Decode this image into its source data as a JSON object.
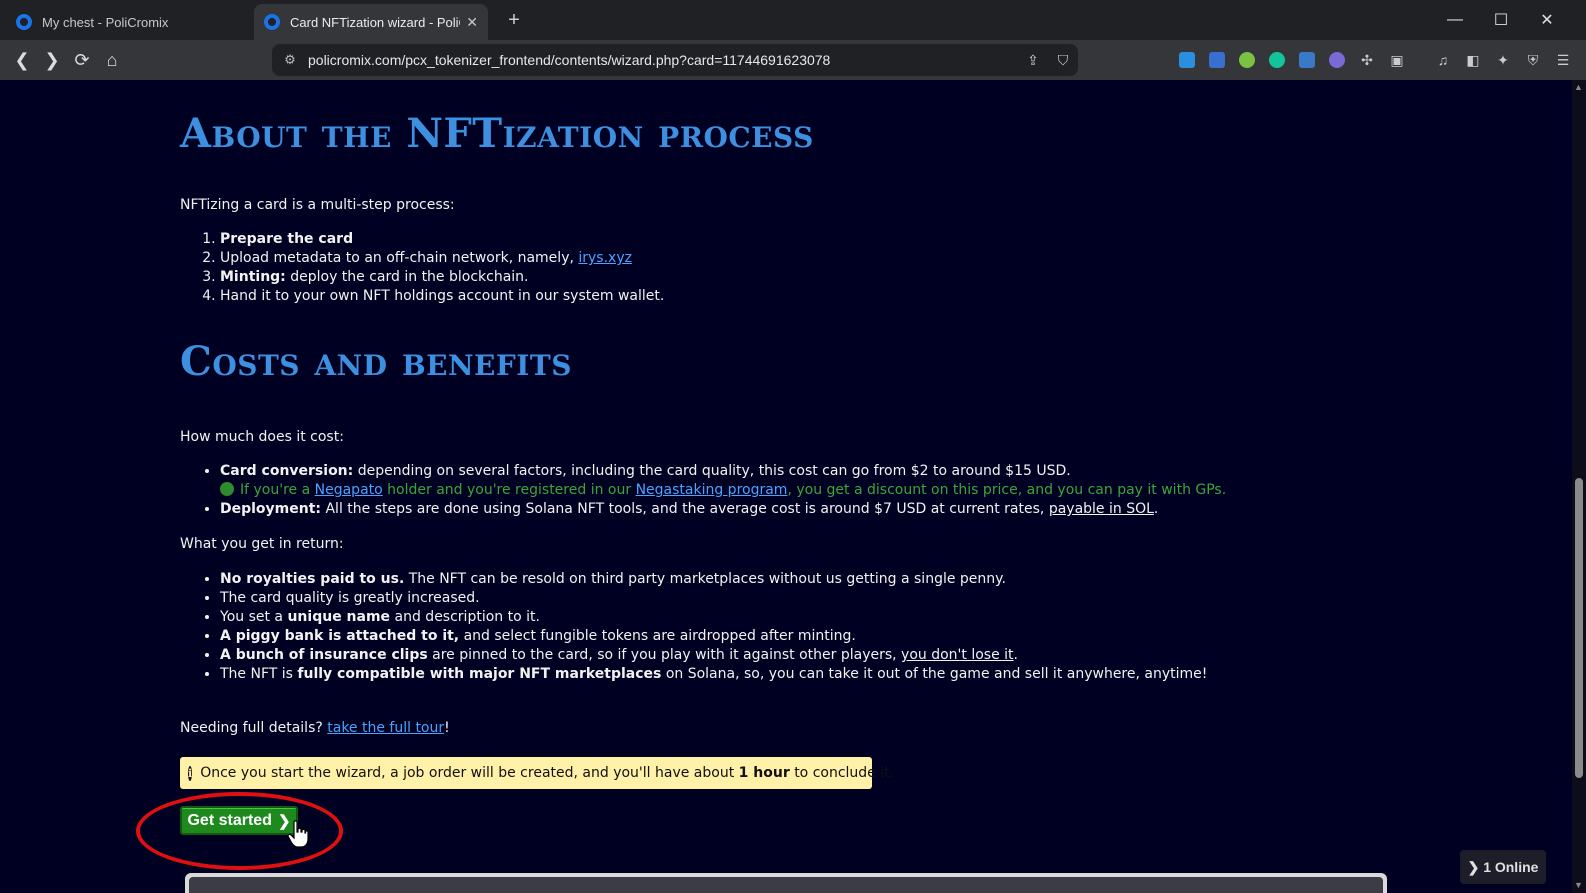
{
  "browser": {
    "tabs": [
      {
        "title": "My chest - PoliCromix",
        "active": false
      },
      {
        "title": "Card NFTization wizard - PoliCromix",
        "active": true
      }
    ],
    "url": "policromix.com/pcx_tokenizer_frontend/contents/wizard.php?card=11744691623078",
    "window_controls": [
      "minimize-icon",
      "maximize-icon",
      "close-icon"
    ]
  },
  "page": {
    "heading1": "About the NFTization process",
    "intro": "NFTizing a card is a multi-step process:",
    "steps": [
      {
        "bold": "Prepare the card",
        "text": "",
        "link": ""
      },
      {
        "bold": "",
        "text": "Upload metadata to an off-chain network, namely, ",
        "link": "irys.xyz"
      },
      {
        "bold": "Minting:",
        "text": " deploy the card in the blockchain.",
        "link": ""
      },
      {
        "bold": "",
        "text": "Hand it to your own NFT holdings account in our system wallet.",
        "link": ""
      }
    ],
    "heading2": "Costs and benefits",
    "cost_intro": "How much does it cost:",
    "costs": {
      "conversion_bold": "Card conversion:",
      "conversion_text": " depending on several factors, including the card quality, this cost can go from $2 to around $15 USD.",
      "discount_pre": "If you're a ",
      "discount_link1": "Negapato",
      "discount_mid": " holder and you're registered in our ",
      "discount_link2": "Negastaking program",
      "discount_post": ", you get a discount on this price, and you can pay it with GPs.",
      "deployment_bold": "Deployment:",
      "deployment_text": " All the steps are done using Solana NFT tools, and the average cost is around $7 USD at current rates, ",
      "deployment_link": "payable in SOL",
      "deployment_end": "."
    },
    "return_intro": "What you get in return:",
    "benefits": {
      "b1_bold": "No royalties paid to us.",
      "b1_text": " The NFT can be resold on third party marketplaces without us getting a single penny.",
      "b2_text": "The card quality is greatly increased.",
      "b3_pre": "You set a ",
      "b3_bold": "unique name",
      "b3_post": " and description to it.",
      "b4_bold": "A piggy bank is attached to it,",
      "b4_text": " and select fungible tokens are airdropped after minting.",
      "b5_bold": "A bunch of insurance clips",
      "b5_text": " are pinned to the card, so if you play with it against other players, ",
      "b5_link": "you don't lose it",
      "b5_end": ".",
      "b6_pre": "The NFT is ",
      "b6_bold": "fully compatible with major NFT marketplaces",
      "b6_post": " on Solana, so, you can take it out of the game and sell it anywhere, anytime!"
    },
    "details_pre": "Needing full details? ",
    "details_link": "take the full tour",
    "details_end": "!",
    "notice_pre": "Once you start the wizard, a job order will be created, and you'll have about ",
    "notice_bold": "1 hour",
    "notice_post": " to conclude it.",
    "start_button": "Get started",
    "online_badge": "1 Online"
  },
  "colors": {
    "page_bg": "#000022",
    "heading": "#3d8fe0",
    "link": "#4aa3ff",
    "discount_text": "#3aa63a",
    "notice_bg": "#fff1a8",
    "button_bg": "#1e8a1e",
    "highlight_ring": "#e01010"
  }
}
